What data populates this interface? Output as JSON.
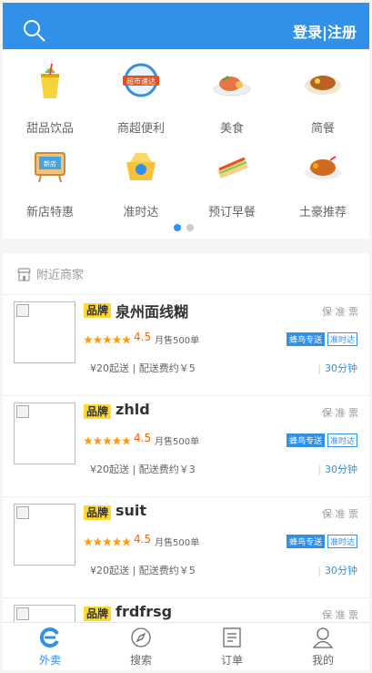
{
  "header": {
    "search_icon": "search-icon",
    "auth": "登录|注册"
  },
  "categories": [
    {
      "label": "甜品饮品",
      "icon": "drink-icon"
    },
    {
      "label": "商超便利",
      "icon": "supermarket-icon",
      "badge": "超市速达"
    },
    {
      "label": "美食",
      "icon": "food-icon"
    },
    {
      "label": "简餐",
      "icon": "meal-icon"
    },
    {
      "label": "新店特惠",
      "icon": "new-store-icon",
      "badge": "新店"
    },
    {
      "label": "准时达",
      "icon": "on-time-icon"
    },
    {
      "label": "预订早餐",
      "icon": "breakfast-icon"
    },
    {
      "label": "土豪推荐",
      "icon": "recommend-icon"
    }
  ],
  "carousel": {
    "pages": 2,
    "active": 0
  },
  "shops_section": {
    "title": "附近商家"
  },
  "shops": [
    {
      "brand": "品牌",
      "name": "泉州面线糊",
      "guarantee": "保 准 票",
      "rating": "4.5",
      "monthly": "月售500单",
      "delivery_tag": "蜂鸟专送",
      "ontime_tag": "准时达",
      "fees": "¥20起送 | 配送费约￥5",
      "time": "30分钟"
    },
    {
      "brand": "品牌",
      "name": "zhld",
      "guarantee": "保 准 票",
      "rating": "4.5",
      "monthly": "月售500单",
      "delivery_tag": "蜂鸟专送",
      "ontime_tag": "准时达",
      "fees": "¥20起送 | 配送费约￥3",
      "time": "30分钟"
    },
    {
      "brand": "品牌",
      "name": "suit",
      "guarantee": "保 准 票",
      "rating": "4.5",
      "monthly": "月售500单",
      "delivery_tag": "蜂鸟专送",
      "ontime_tag": "准时达",
      "fees": "¥20起送 | 配送费约￥5",
      "time": "30分钟"
    },
    {
      "brand": "品牌",
      "name": "frdfrsg",
      "guarantee": "保 准 票"
    }
  ],
  "footer": [
    {
      "label": "外卖",
      "icon": "takeout-icon",
      "active": true
    },
    {
      "label": "搜索",
      "icon": "compass-icon"
    },
    {
      "label": "订单",
      "icon": "order-icon"
    },
    {
      "label": "我的",
      "icon": "profile-icon"
    }
  ],
  "colors": {
    "primary": "#3190e8",
    "brand_tag": "#ffd930",
    "rating": "#ff6000"
  }
}
